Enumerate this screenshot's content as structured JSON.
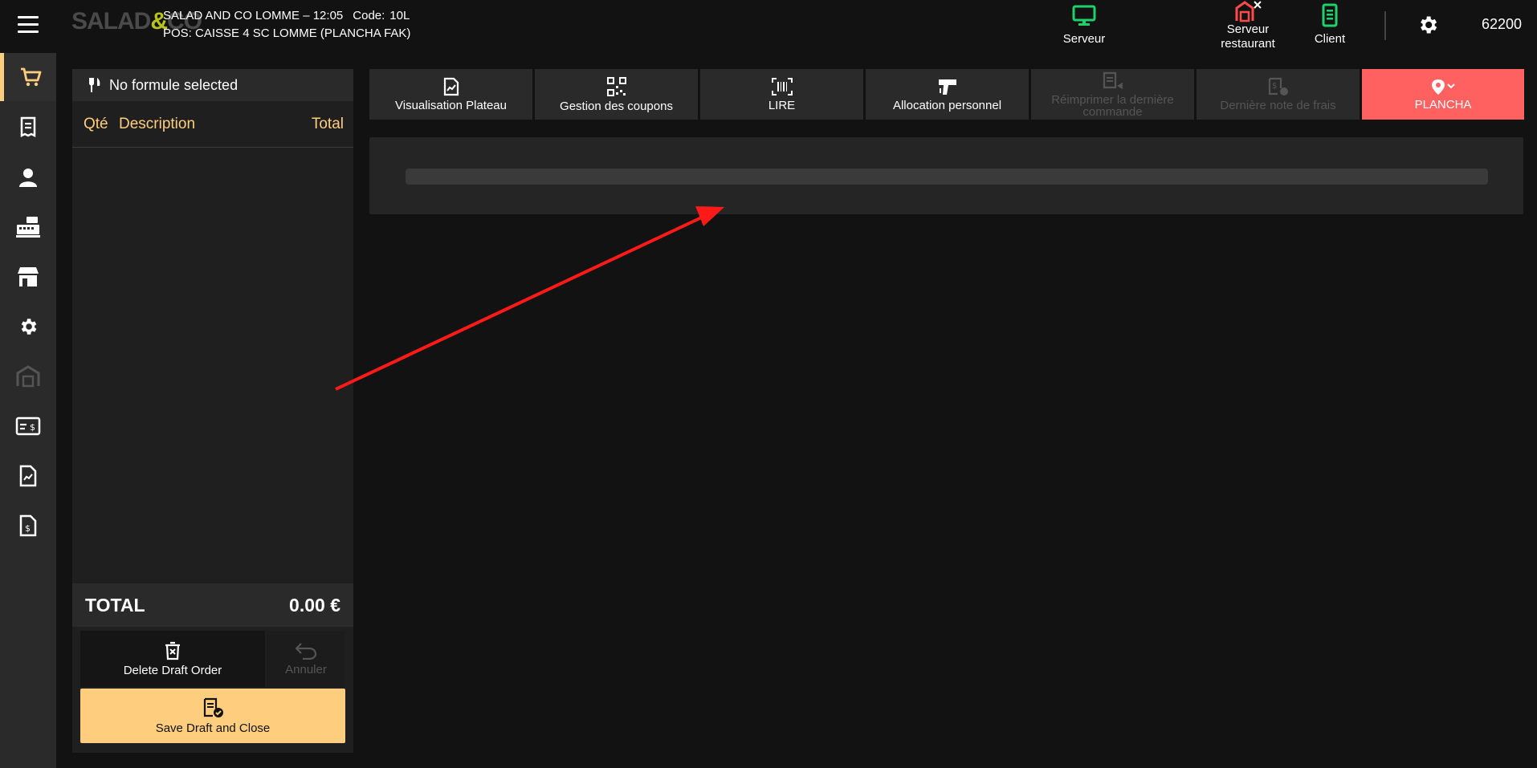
{
  "header": {
    "logo_text_left": "SALAD",
    "logo_amp": "&",
    "logo_text_right": "CO",
    "store_time": "SALAD AND CO LOMME – 12:05",
    "code_label": "Code:",
    "code_value": "10L",
    "pos_line": "POS: CAISSE 4 SC LOMME (PLANCHA FAK)",
    "serveur_label": "Serveur",
    "serveur_restaurant_line1": "Serveur",
    "serveur_restaurant_line2": "restaurant",
    "client_label": "Client",
    "zip": "62200"
  },
  "colors": {
    "accent": "#ffcd7e",
    "plancha": "#ff6161",
    "serveur_green": "#1fd16b",
    "restaurant_red": "#ff4a4a"
  },
  "sidebar": {
    "items": [
      {
        "icon": "cart-icon",
        "active": true
      },
      {
        "icon": "receipt-icon"
      },
      {
        "icon": "user-icon"
      },
      {
        "icon": "cash-register-icon"
      },
      {
        "icon": "store-icon"
      },
      {
        "icon": "gear-icon"
      },
      {
        "icon": "warehouse-icon",
        "disabled": true
      },
      {
        "icon": "payment-card-icon"
      },
      {
        "icon": "report-icon"
      },
      {
        "icon": "invoice-icon"
      }
    ]
  },
  "order": {
    "formule": "No formule selected",
    "col_qte": "Qté",
    "col_description": "Description",
    "col_total": "Total",
    "total_label": "TOTAL",
    "total_value": "0.00 €",
    "delete_label": "Delete Draft Order",
    "annuler_label": "Annuler",
    "save_label": "Save Draft and Close"
  },
  "toolbar": {
    "buttons": [
      {
        "label": "Visualisation Plateau",
        "disabled": false
      },
      {
        "label": "Gestion des coupons",
        "disabled": false
      },
      {
        "label": "LIRE",
        "disabled": false
      },
      {
        "label": "Allocation personnel",
        "disabled": false
      },
      {
        "label": "Réimprimer la dernière commande",
        "disabled": true
      },
      {
        "label": "Dernière note de frais",
        "disabled": true
      },
      {
        "label": "PLANCHA",
        "disabled": false
      }
    ]
  }
}
